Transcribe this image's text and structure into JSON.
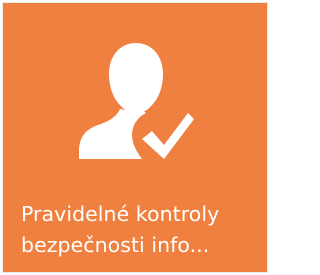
{
  "tile": {
    "title_line1": "Pravidelné kontroly",
    "title_line2": "bezpečnosti info...",
    "icon": "user-check-icon",
    "background_color": "#f0803f",
    "foreground_color": "#ffffff"
  }
}
